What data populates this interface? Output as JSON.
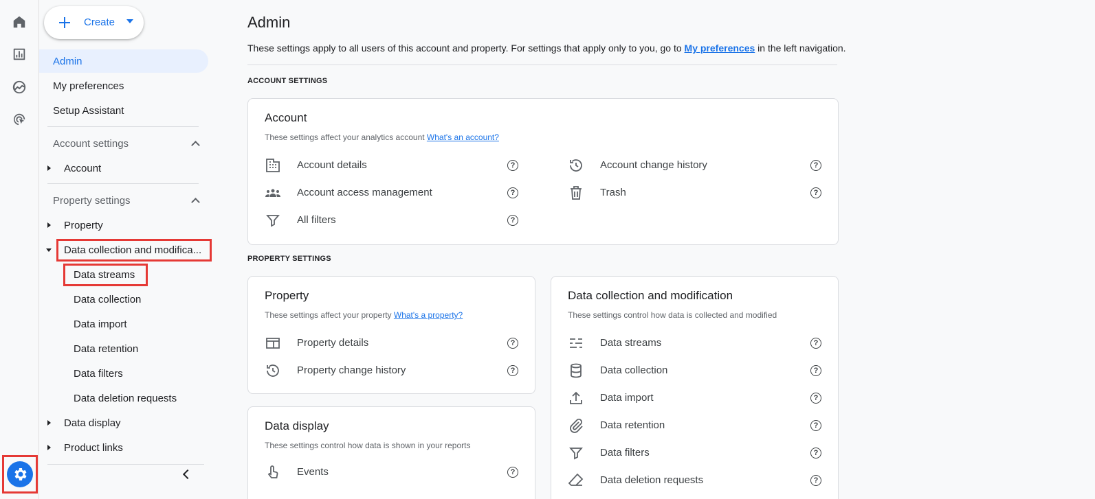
{
  "rail": {
    "items": [
      {
        "icon": "home-icon"
      },
      {
        "icon": "reports-icon"
      },
      {
        "icon": "explore-icon"
      },
      {
        "icon": "advertising-icon"
      }
    ],
    "admin_icon": "gear-icon"
  },
  "create": {
    "label": "Create"
  },
  "nav": {
    "admin": "Admin",
    "my_preferences": "My preferences",
    "setup_assistant": "Setup Assistant",
    "account_settings": "Account settings",
    "account": "Account",
    "property_settings": "Property settings",
    "property": "Property",
    "data_collection_mod": "Data collection and modifica...",
    "sub": {
      "data_streams": "Data streams",
      "data_collection": "Data collection",
      "data_import": "Data import",
      "data_retention": "Data retention",
      "data_filters": "Data filters",
      "data_deletion": "Data deletion requests"
    },
    "data_display": "Data display",
    "product_links": "Product links"
  },
  "main": {
    "title": "Admin",
    "intro_before": "These settings apply to all users of this account and property. For settings that apply only to you, go to ",
    "intro_link": "My preferences",
    "intro_after": " in the left navigation.",
    "account_settings_label": "ACCOUNT SETTINGS",
    "property_settings_label": "PROPERTY SETTINGS"
  },
  "cards": {
    "account": {
      "title": "Account",
      "desc": "These settings affect your analytics account ",
      "link": "What's an account?",
      "items": {
        "details": "Account details",
        "access": "Account access management",
        "filters": "All filters",
        "history": "Account change history",
        "trash": "Trash"
      }
    },
    "property": {
      "title": "Property",
      "desc": "These settings affect your property ",
      "link": "What's a property?",
      "items": {
        "details": "Property details",
        "history": "Property change history"
      }
    },
    "data_collection": {
      "title": "Data collection and modification",
      "desc": "These settings control how data is collected and modified",
      "items": {
        "streams": "Data streams",
        "collection": "Data collection",
        "import": "Data import",
        "retention": "Data retention",
        "filters": "Data filters",
        "deletion": "Data deletion requests"
      }
    },
    "data_display": {
      "title": "Data display",
      "desc": "These settings control how data is shown in your reports",
      "items": {
        "events": "Events"
      }
    }
  },
  "help_glyph": "?"
}
